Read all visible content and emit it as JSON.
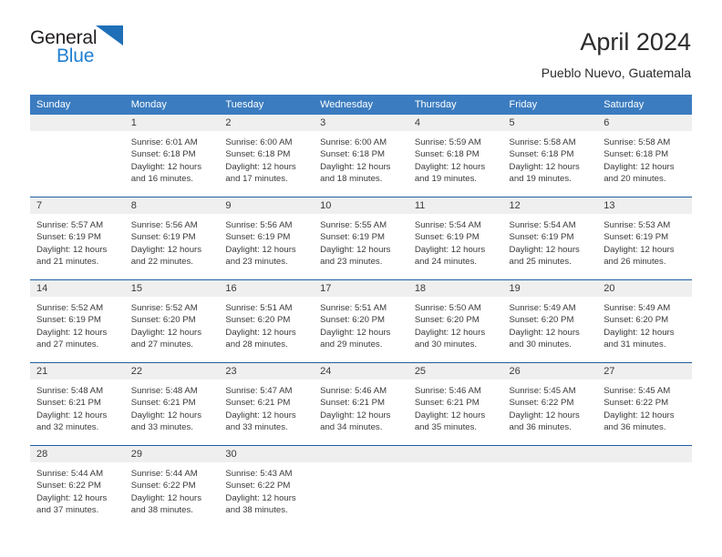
{
  "brand": {
    "name_part1": "General",
    "name_part2": "Blue",
    "triangle_icon": "blue-triangle-icon",
    "colors": {
      "dark": "#231f20",
      "blue": "#1f7fd1"
    }
  },
  "header": {
    "title": "April 2024",
    "subtitle": "Pueblo Nuevo, Guatemala"
  },
  "colors": {
    "header_bg": "#3b7cc0",
    "header_text": "#ffffff",
    "daynum_bg": "#efefef",
    "week_divider": "#1f5fa0",
    "body_text": "#3a3a3a"
  },
  "weekday_headers": [
    "Sunday",
    "Monday",
    "Tuesday",
    "Wednesday",
    "Thursday",
    "Friday",
    "Saturday"
  ],
  "weeks": [
    [
      {
        "day": "",
        "lines": []
      },
      {
        "day": "1",
        "lines": [
          "Sunrise: 6:01 AM",
          "Sunset: 6:18 PM",
          "Daylight: 12 hours",
          "and 16 minutes."
        ]
      },
      {
        "day": "2",
        "lines": [
          "Sunrise: 6:00 AM",
          "Sunset: 6:18 PM",
          "Daylight: 12 hours",
          "and 17 minutes."
        ]
      },
      {
        "day": "3",
        "lines": [
          "Sunrise: 6:00 AM",
          "Sunset: 6:18 PM",
          "Daylight: 12 hours",
          "and 18 minutes."
        ]
      },
      {
        "day": "4",
        "lines": [
          "Sunrise: 5:59 AM",
          "Sunset: 6:18 PM",
          "Daylight: 12 hours",
          "and 19 minutes."
        ]
      },
      {
        "day": "5",
        "lines": [
          "Sunrise: 5:58 AM",
          "Sunset: 6:18 PM",
          "Daylight: 12 hours",
          "and 19 minutes."
        ]
      },
      {
        "day": "6",
        "lines": [
          "Sunrise: 5:58 AM",
          "Sunset: 6:18 PM",
          "Daylight: 12 hours",
          "and 20 minutes."
        ]
      }
    ],
    [
      {
        "day": "7",
        "lines": [
          "Sunrise: 5:57 AM",
          "Sunset: 6:19 PM",
          "Daylight: 12 hours",
          "and 21 minutes."
        ]
      },
      {
        "day": "8",
        "lines": [
          "Sunrise: 5:56 AM",
          "Sunset: 6:19 PM",
          "Daylight: 12 hours",
          "and 22 minutes."
        ]
      },
      {
        "day": "9",
        "lines": [
          "Sunrise: 5:56 AM",
          "Sunset: 6:19 PM",
          "Daylight: 12 hours",
          "and 23 minutes."
        ]
      },
      {
        "day": "10",
        "lines": [
          "Sunrise: 5:55 AM",
          "Sunset: 6:19 PM",
          "Daylight: 12 hours",
          "and 23 minutes."
        ]
      },
      {
        "day": "11",
        "lines": [
          "Sunrise: 5:54 AM",
          "Sunset: 6:19 PM",
          "Daylight: 12 hours",
          "and 24 minutes."
        ]
      },
      {
        "day": "12",
        "lines": [
          "Sunrise: 5:54 AM",
          "Sunset: 6:19 PM",
          "Daylight: 12 hours",
          "and 25 minutes."
        ]
      },
      {
        "day": "13",
        "lines": [
          "Sunrise: 5:53 AM",
          "Sunset: 6:19 PM",
          "Daylight: 12 hours",
          "and 26 minutes."
        ]
      }
    ],
    [
      {
        "day": "14",
        "lines": [
          "Sunrise: 5:52 AM",
          "Sunset: 6:19 PM",
          "Daylight: 12 hours",
          "and 27 minutes."
        ]
      },
      {
        "day": "15",
        "lines": [
          "Sunrise: 5:52 AM",
          "Sunset: 6:20 PM",
          "Daylight: 12 hours",
          "and 27 minutes."
        ]
      },
      {
        "day": "16",
        "lines": [
          "Sunrise: 5:51 AM",
          "Sunset: 6:20 PM",
          "Daylight: 12 hours",
          "and 28 minutes."
        ]
      },
      {
        "day": "17",
        "lines": [
          "Sunrise: 5:51 AM",
          "Sunset: 6:20 PM",
          "Daylight: 12 hours",
          "and 29 minutes."
        ]
      },
      {
        "day": "18",
        "lines": [
          "Sunrise: 5:50 AM",
          "Sunset: 6:20 PM",
          "Daylight: 12 hours",
          "and 30 minutes."
        ]
      },
      {
        "day": "19",
        "lines": [
          "Sunrise: 5:49 AM",
          "Sunset: 6:20 PM",
          "Daylight: 12 hours",
          "and 30 minutes."
        ]
      },
      {
        "day": "20",
        "lines": [
          "Sunrise: 5:49 AM",
          "Sunset: 6:20 PM",
          "Daylight: 12 hours",
          "and 31 minutes."
        ]
      }
    ],
    [
      {
        "day": "21",
        "lines": [
          "Sunrise: 5:48 AM",
          "Sunset: 6:21 PM",
          "Daylight: 12 hours",
          "and 32 minutes."
        ]
      },
      {
        "day": "22",
        "lines": [
          "Sunrise: 5:48 AM",
          "Sunset: 6:21 PM",
          "Daylight: 12 hours",
          "and 33 minutes."
        ]
      },
      {
        "day": "23",
        "lines": [
          "Sunrise: 5:47 AM",
          "Sunset: 6:21 PM",
          "Daylight: 12 hours",
          "and 33 minutes."
        ]
      },
      {
        "day": "24",
        "lines": [
          "Sunrise: 5:46 AM",
          "Sunset: 6:21 PM",
          "Daylight: 12 hours",
          "and 34 minutes."
        ]
      },
      {
        "day": "25",
        "lines": [
          "Sunrise: 5:46 AM",
          "Sunset: 6:21 PM",
          "Daylight: 12 hours",
          "and 35 minutes."
        ]
      },
      {
        "day": "26",
        "lines": [
          "Sunrise: 5:45 AM",
          "Sunset: 6:22 PM",
          "Daylight: 12 hours",
          "and 36 minutes."
        ]
      },
      {
        "day": "27",
        "lines": [
          "Sunrise: 5:45 AM",
          "Sunset: 6:22 PM",
          "Daylight: 12 hours",
          "and 36 minutes."
        ]
      }
    ],
    [
      {
        "day": "28",
        "lines": [
          "Sunrise: 5:44 AM",
          "Sunset: 6:22 PM",
          "Daylight: 12 hours",
          "and 37 minutes."
        ]
      },
      {
        "day": "29",
        "lines": [
          "Sunrise: 5:44 AM",
          "Sunset: 6:22 PM",
          "Daylight: 12 hours",
          "and 38 minutes."
        ]
      },
      {
        "day": "30",
        "lines": [
          "Sunrise: 5:43 AM",
          "Sunset: 6:22 PM",
          "Daylight: 12 hours",
          "and 38 minutes."
        ]
      },
      {
        "day": "",
        "lines": []
      },
      {
        "day": "",
        "lines": []
      },
      {
        "day": "",
        "lines": []
      },
      {
        "day": "",
        "lines": []
      }
    ]
  ]
}
